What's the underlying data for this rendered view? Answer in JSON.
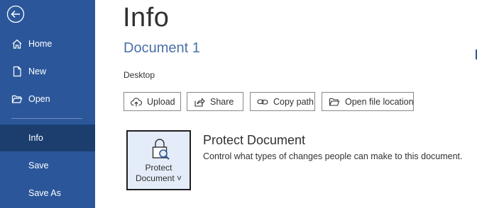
{
  "sidebar": {
    "items": [
      {
        "label": "Home",
        "icon": "home-icon"
      },
      {
        "label": "New",
        "icon": "new-document-icon"
      },
      {
        "label": "Open",
        "icon": "open-folder-icon"
      },
      {
        "label": "Info",
        "active": true
      },
      {
        "label": "Save"
      },
      {
        "label": "Save As"
      }
    ],
    "back_icon": "back-arrow-icon",
    "colors": {
      "background": "#2b579a",
      "active": "#1b3e6f"
    }
  },
  "main": {
    "title": "Info",
    "document_name": "Document 1",
    "location": "Desktop",
    "actions": [
      {
        "label": "Upload",
        "icon": "upload-cloud-icon"
      },
      {
        "label": "Share",
        "icon": "share-icon"
      },
      {
        "label": "Copy path",
        "icon": "link-icon"
      },
      {
        "label": "Open file location",
        "icon": "folder-open-icon"
      }
    ],
    "protect": {
      "tile_line1": "Protect",
      "tile_line2": "Document ˅",
      "title": "Protect Document",
      "description": "Control what types of changes people can make to this document."
    }
  }
}
